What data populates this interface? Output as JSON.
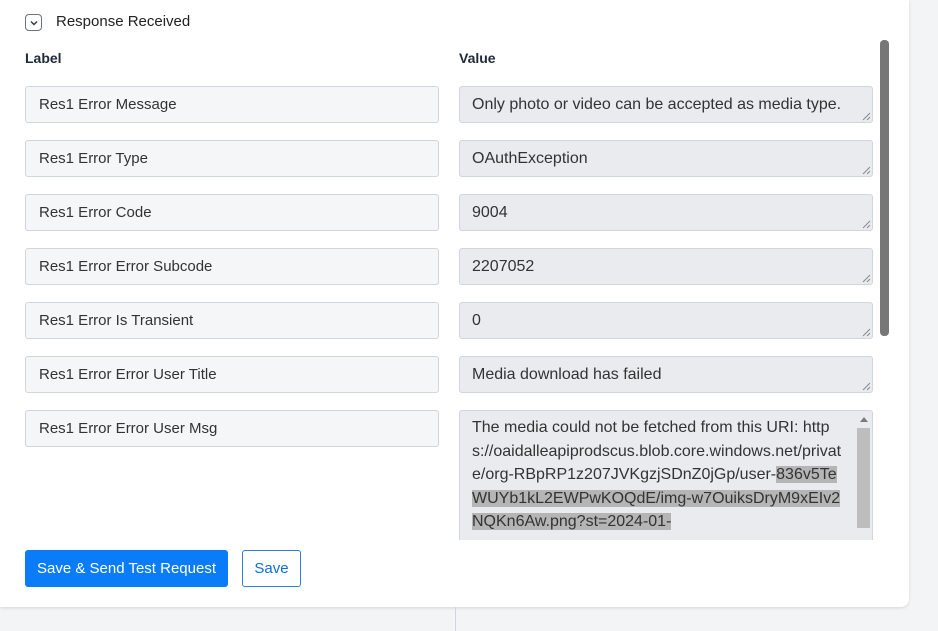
{
  "section": {
    "title": "Response Received"
  },
  "columns": {
    "label": "Label",
    "value": "Value"
  },
  "rows": [
    {
      "label": "Res1 Error Message",
      "value": "Only photo or video can be accepted as media type."
    },
    {
      "label": "Res1 Error Type",
      "value": "OAuthException"
    },
    {
      "label": "Res1 Error Code",
      "value": "9004"
    },
    {
      "label": "Res1 Error Error Subcode",
      "value": "2207052"
    },
    {
      "label": "Res1 Error Is Transient",
      "value": "0"
    },
    {
      "label": "Res1 Error Error User Title",
      "value": "Media download has failed"
    }
  ],
  "long_row": {
    "label": "Res1 Error Error User Msg",
    "value_plain": "The media could not be fetched from this URI: https://oaidalleapiprodscus.blob.core.windows.net/private/org-RBpRP1z207JVKgzjSDnZ0jGp/user-",
    "value_selected": "836v5TeWUYb1kL2EWPwKOQdE/img-w7OuiksDryM9xEIv2NQKn6Aw.png?st=2024-01-"
  },
  "buttons": {
    "save_send": "Save & Send Test Request",
    "save": "Save"
  },
  "colors": {
    "primary": "#0a7cf8",
    "label_bg": "#f4f6f8",
    "value_bg": "#e9ebee"
  }
}
